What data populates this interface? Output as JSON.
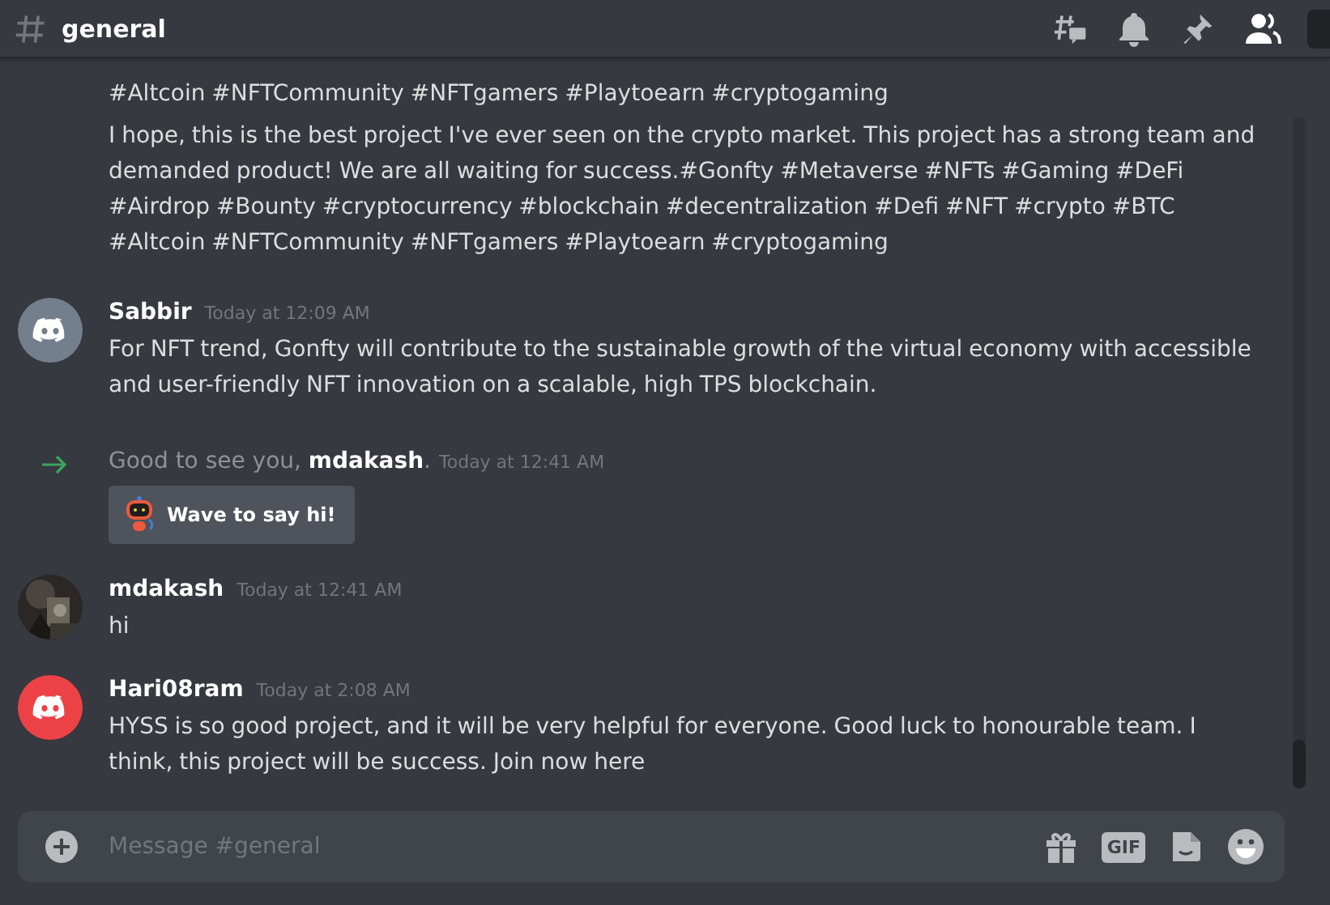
{
  "channel": {
    "name": "general"
  },
  "messages": [
    {
      "kind": "continuation",
      "paragraphs": [
        "#Altcoin #NFTCommunity #NFTgamers  #Playtoearn #cryptogaming",
        "I hope, this is the best project I've ever seen on the crypto market. This project has a strong team and demanded product! We are all waiting for success.#Gonfty #Metaverse #NFTs #Gaming #DeFi #Airdrop #Bounty #cryptocurrency #blockchain #decentralization #Defi #NFT #crypto #BTC #Altcoin #NFTCommunity #NFTgamers  #Playtoearn #cryptogaming"
      ]
    },
    {
      "kind": "message",
      "author": "Sabbir",
      "time": "Today at 12:09 AM",
      "avatar": {
        "kind": "logo",
        "color": "#747f8d"
      },
      "paragraphs": [
        "For NFT trend, Gonfty will contribute to the sustainable growth of the virtual economy with accessible and user-friendly NFT innovation on a scalable, high TPS blockchain."
      ]
    },
    {
      "kind": "join",
      "text": "Good to see you, **mdakash**.",
      "time": "Today at 12:41 AM",
      "button": "Wave to say hi!"
    },
    {
      "kind": "message",
      "author": "mdakash",
      "time": "Today at 12:41 AM",
      "avatar": {
        "kind": "picture"
      },
      "paragraphs": [
        "hi"
      ]
    },
    {
      "kind": "message",
      "author": "Hari08ram",
      "time": "Today at 2:08 AM",
      "avatar": {
        "kind": "logo",
        "color": "#ed4245"
      },
      "paragraphs": [
        "HYSS is so good project, and it will be very helpful for everyone. Good luck to honourable team. I think, this project will be success.  Join now here"
      ]
    }
  ],
  "composer": {
    "placeholder": "Message #general",
    "gif_label": "GIF"
  }
}
